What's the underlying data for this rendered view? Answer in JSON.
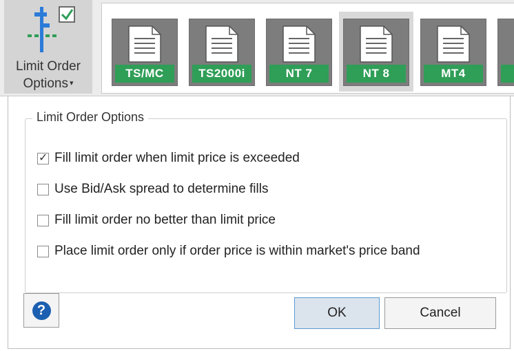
{
  "ribbon": {
    "limit_order_button": {
      "label_line1": "Limit Order",
      "label_line2": "Options",
      "caret": "▾",
      "icon": "limit-order-options-icon"
    },
    "platforms": [
      {
        "label": "TS/MC",
        "selected": false
      },
      {
        "label": "TS2000i",
        "selected": false
      },
      {
        "label": "NT 7",
        "selected": false
      },
      {
        "label": "NT 8",
        "selected": true
      },
      {
        "label": "MT4",
        "selected": false
      },
      {
        "label": "",
        "selected": false
      }
    ],
    "colors": {
      "platform_label": "#2f9e57",
      "card": "#7d7d7d"
    }
  },
  "dialog": {
    "group_title": "Limit Order Options",
    "options": [
      {
        "label": "Fill limit order when limit price is exceeded",
        "checked": true
      },
      {
        "label": "Use Bid/Ask spread to determine fills",
        "checked": false
      },
      {
        "label": "Fill limit order no better than limit price",
        "checked": false
      },
      {
        "label": "Place limit order only if order price is within market's price band",
        "checked": false
      }
    ],
    "help_glyph": "?",
    "ok_label": "OK",
    "cancel_label": "Cancel",
    "accent_color": "#5b9bd5"
  }
}
